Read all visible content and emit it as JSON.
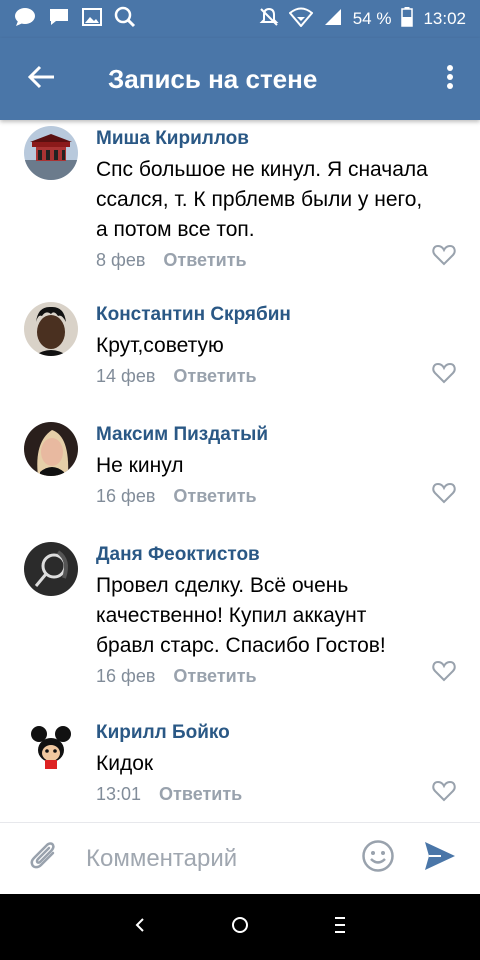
{
  "status_bar": {
    "battery": "54 %",
    "time": "13:02",
    "left_icons": [
      "message-bubble-icon",
      "chat-icon",
      "image-icon",
      "search-icon"
    ],
    "right_icons": [
      "bell-off-icon",
      "wifi-icon",
      "signal-icon",
      "battery-icon"
    ]
  },
  "header": {
    "title": "Запись на стене",
    "back_icon": "arrow-left-icon",
    "menu_icon": "more-vertical-icon"
  },
  "comments": [
    {
      "author": "Миша Кириллов",
      "text": "Спс большое не кинул. Я сначала\nссался, т. К прблемв были у него,\nа потом все топ.",
      "date": "8 фев",
      "reply_label": "Ответить"
    },
    {
      "author": "Константин Скрябин",
      "text": "Крут,советую",
      "date": "14 фев",
      "reply_label": "Ответить"
    },
    {
      "author": "Максим Пиздатый",
      "text": "Не кинул",
      "date": "16 фев",
      "reply_label": "Ответить"
    },
    {
      "author": "Даня Феоктистов",
      "text": "Провел сделку. Всё очень\nкачественно! Купил аккаунт\nбравл старс. Спасибо Гостов!",
      "date": "16 фев",
      "reply_label": "Ответить"
    },
    {
      "author": "Кирилл Бойко",
      "text": "Кидок",
      "date": "13:01",
      "reply_label": "Ответить"
    }
  ],
  "composer": {
    "placeholder": "Комментарий",
    "value": ""
  },
  "colors": {
    "header_bg": "#4a76a8",
    "author_name": "#2a5885",
    "meta_text": "#818c99",
    "send_icon": "#4a76a8"
  }
}
